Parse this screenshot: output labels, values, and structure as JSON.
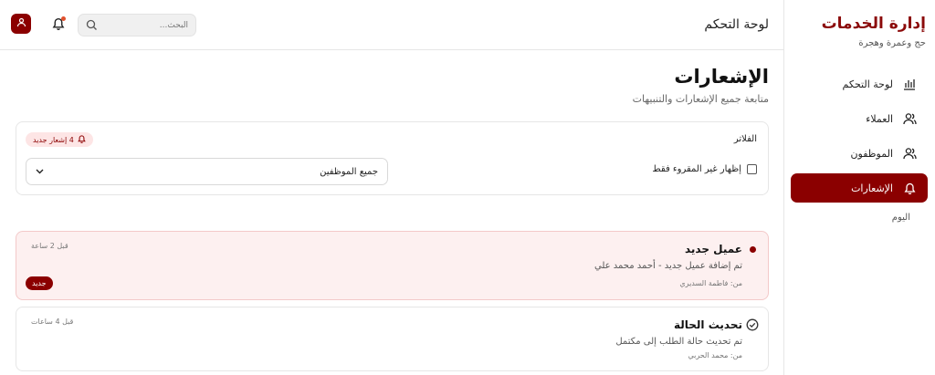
{
  "sidebar": {
    "brand_title": "إدارة الخدمات",
    "brand_subtitle": "حج وعمرة وهجرة",
    "items": [
      {
        "label": "لوحة التحكم",
        "icon": "chart-icon",
        "active": false
      },
      {
        "label": "العملاء",
        "icon": "users-icon",
        "active": false
      },
      {
        "label": "الموظفون",
        "icon": "user-group-icon",
        "active": false
      },
      {
        "label": "الإشعارات",
        "icon": "bell-icon",
        "active": true
      }
    ]
  },
  "header": {
    "title": "لوحة التحكم",
    "search_placeholder": "البحث..."
  },
  "page": {
    "title": "الإشعارات",
    "subtitle": "متابعة جميع الإشعارات والتنبيهات"
  },
  "filters": {
    "label": "الفلاتر",
    "new_badge": "4 إشعار جديد",
    "unread_only_label": "إظهار غير المقروء فقط",
    "employee_select_value": "جميع الموظفين"
  },
  "groups": {
    "today_label": "اليوم"
  },
  "notifications": [
    {
      "title": "عميل جديد",
      "body": "تم إضافة عميل جديد - أحمد محمد علي",
      "from": "من: فاطمة السديري",
      "time": "قبل 2 ساعة",
      "new_label": "جديد",
      "unread": true
    },
    {
      "title": "تحديث الحالة",
      "body": "تم تحديث حالة الطلب إلى مكتمل",
      "from": "من: محمد الحربي",
      "time": "قبل 4 ساعات",
      "unread": false
    }
  ],
  "colors": {
    "accent": "#8b0000",
    "brand": "#8b0a0a",
    "unread_bg": "#fdf0f0",
    "badge_bg": "#fde5e5",
    "alert_dot": "#e0512e"
  }
}
